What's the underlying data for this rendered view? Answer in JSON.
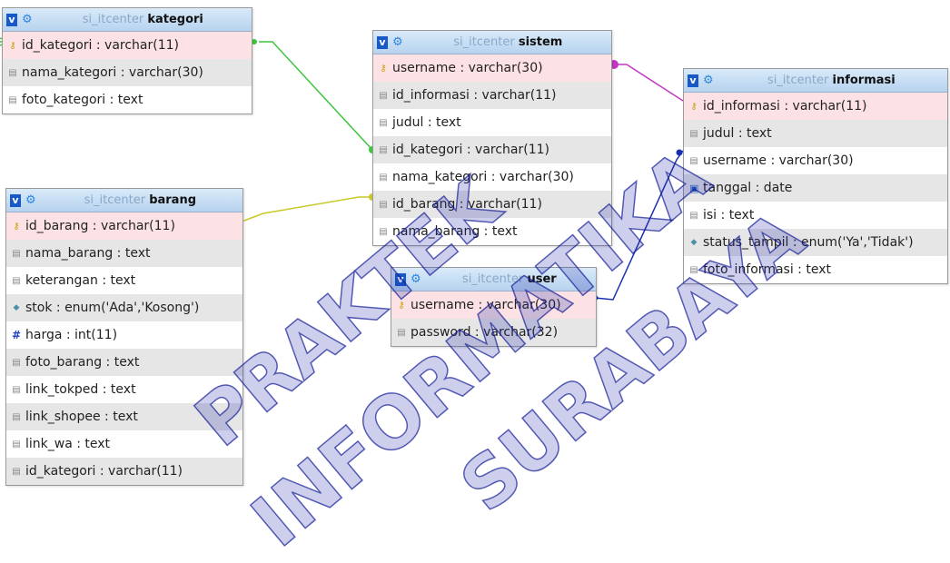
{
  "tables": {
    "kategori": {
      "db": "si_itcenter",
      "name": "kategori",
      "columns": [
        {
          "icon": "primary-key-icon",
          "text": "id_kategori : varchar(11)"
        },
        {
          "icon": "text-field-icon",
          "text": "nama_kategori : varchar(30)"
        },
        {
          "icon": "text-field-icon",
          "text": "foto_kategori : text"
        }
      ]
    },
    "barang": {
      "db": "si_itcenter",
      "name": "barang",
      "columns": [
        {
          "icon": "primary-key-icon",
          "text": "id_barang : varchar(11)"
        },
        {
          "icon": "text-field-icon",
          "text": "nama_barang : text"
        },
        {
          "icon": "text-field-icon",
          "text": "keterangan : text"
        },
        {
          "icon": "enum-field-icon",
          "text": "stok : enum('Ada','Kosong')"
        },
        {
          "icon": "numeric-field-icon",
          "text": "harga : int(11)"
        },
        {
          "icon": "text-field-icon",
          "text": "foto_barang : text"
        },
        {
          "icon": "text-field-icon",
          "text": "link_tokped : text"
        },
        {
          "icon": "text-field-icon",
          "text": "link_shopee : text"
        },
        {
          "icon": "text-field-icon",
          "text": "link_wa : text"
        },
        {
          "icon": "text-field-icon",
          "text": "id_kategori : varchar(11)"
        }
      ]
    },
    "sistem": {
      "db": "si_itcenter",
      "name": "sistem",
      "columns": [
        {
          "icon": "primary-key-icon",
          "text": "username : varchar(30)"
        },
        {
          "icon": "text-field-icon",
          "text": "id_informasi : varchar(11)"
        },
        {
          "icon": "text-field-icon",
          "text": "judul : text"
        },
        {
          "icon": "text-field-icon",
          "text": "id_kategori : varchar(11)"
        },
        {
          "icon": "text-field-icon",
          "text": "nama_kategori : varchar(30)"
        },
        {
          "icon": "text-field-icon",
          "text": "id_barang : varchar(11)"
        },
        {
          "icon": "text-field-icon",
          "text": "nama_barang : text"
        }
      ]
    },
    "user": {
      "db": "si_itcenter",
      "name": "user",
      "columns": [
        {
          "icon": "primary-key-icon",
          "text": "username : varchar(30)"
        },
        {
          "icon": "text-field-icon",
          "text": "password : varchar(32)"
        }
      ]
    },
    "informasi": {
      "db": "si_itcenter",
      "name": "informasi",
      "columns": [
        {
          "icon": "primary-key-icon",
          "text": "id_informasi : varchar(11)"
        },
        {
          "icon": "text-field-icon",
          "text": "judul : text"
        },
        {
          "icon": "text-field-icon",
          "text": "username : varchar(30)"
        },
        {
          "icon": "date-field-icon",
          "text": "tanggal : date"
        },
        {
          "icon": "text-field-icon",
          "text": "isi : text"
        },
        {
          "icon": "enum-field-icon",
          "text": "status_tampil : enum('Ya','Tidak')"
        },
        {
          "icon": "text-field-icon",
          "text": "foto_informasi : text"
        }
      ]
    }
  },
  "relations": [
    {
      "from": "kategori",
      "to": "sistem",
      "color": "#3fc43f"
    },
    {
      "from": "barang",
      "to": "sistem",
      "color": "#c9c92a"
    },
    {
      "from": "sistem",
      "to": "informasi",
      "color": "#c236c2"
    },
    {
      "from": "user",
      "to": "informasi",
      "color": "#1a2fb0"
    }
  ],
  "watermark": {
    "lines": [
      "PRAKTEK",
      "INFORMATIKA",
      "SURABAYA"
    ],
    "color": "#1c26aa"
  }
}
